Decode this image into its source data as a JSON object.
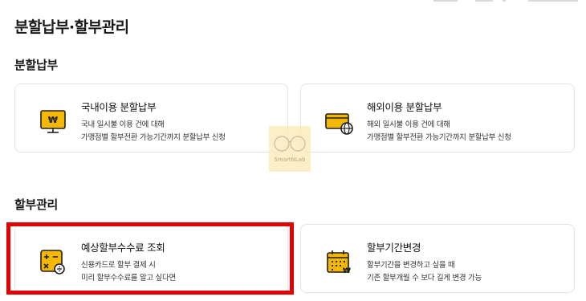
{
  "page": {
    "title": "분할납부·할부관리"
  },
  "sections": {
    "split_payment": "분할납부",
    "installment_management": "할부관리"
  },
  "cards": {
    "domestic": {
      "title": "국내이용 분할납부",
      "desc1": "국내 일시불 이용 건에 대해",
      "desc2": "가맹점별 할부전환 가능기간까지 분할납부 신청",
      "icon": "monitor-won-icon"
    },
    "overseas": {
      "title": "해외이용 분할납부",
      "desc1": "해외 일시불 이용 건에 대해",
      "desc2": "가맹점별 할부전환 가능기간까지 분할납부 신청",
      "icon": "card-globe-icon"
    },
    "fee_inquiry": {
      "title": "예상할부수수료 조회",
      "desc1": "신용카드로 할부 결제 시",
      "desc2": "미리 할부수수료를 알고 싶다면",
      "icon": "calculator-icon"
    },
    "period_change": {
      "title": "할부기간변경",
      "desc1": "할부기간을 변경하고 싶을 때",
      "desc2": "기존 할부개월 수 보다 길게 변경 가능",
      "icon": "calendar-won-icon"
    }
  },
  "watermark": {
    "text": "SmartNLab"
  },
  "colors": {
    "accent": "#f5b800",
    "highlight": "#e50000",
    "icon_dark": "#1f1f1f"
  }
}
